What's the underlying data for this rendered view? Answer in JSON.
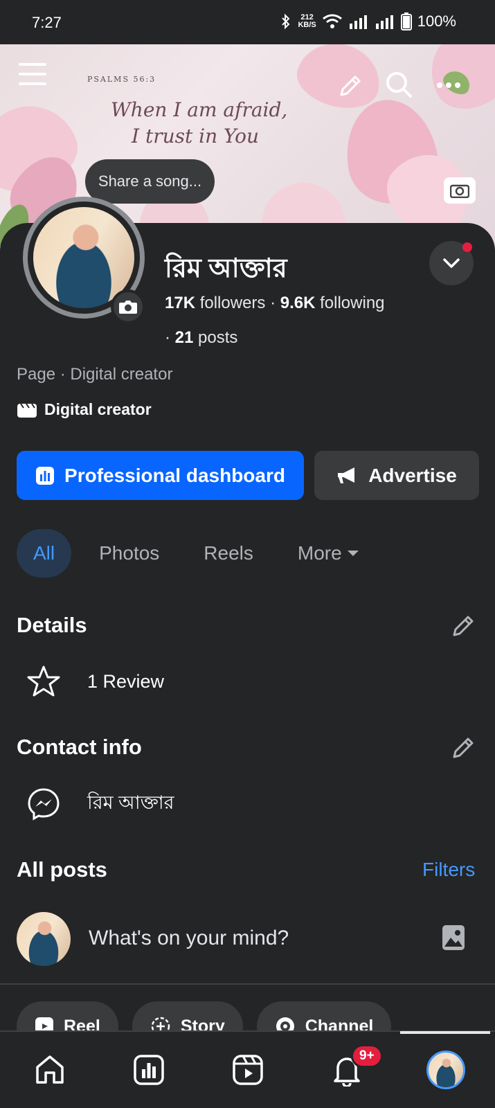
{
  "status_bar": {
    "time": "7:27",
    "network_speed_value": "212",
    "network_speed_unit": "KB/S",
    "battery": "100%"
  },
  "cover": {
    "verse_label": "PSALMS 56:3",
    "verse_line1": "When I am afraid,",
    "verse_line2": "I trust in You"
  },
  "song_tooltip": "Share a song...",
  "profile": {
    "name": "রিম আক্তার",
    "followers_count": "17K",
    "followers_label": "followers",
    "following_count": "9.6K",
    "following_label": "following",
    "posts_count": "21",
    "posts_label": "posts",
    "subtitle": "Page · Digital creator",
    "category": "Digital creator"
  },
  "actions": {
    "primary": "Professional dashboard",
    "secondary": "Advertise"
  },
  "tabs": [
    {
      "label": "All",
      "active": true
    },
    {
      "label": "Photos"
    },
    {
      "label": "Reels"
    },
    {
      "label": "More"
    }
  ],
  "details": {
    "title": "Details",
    "review": "1 Review"
  },
  "contact": {
    "title": "Contact info",
    "messenger": "রিম আক্তার"
  },
  "posts": {
    "title": "All posts",
    "filters": "Filters",
    "composer_placeholder": "What's on your mind?"
  },
  "chips": [
    {
      "label": "Reel"
    },
    {
      "label": "Story"
    },
    {
      "label": "Channel"
    }
  ],
  "bottom_nav": {
    "notifications_badge": "9+"
  },
  "colors": {
    "accent_blue": "#0866ff",
    "link_blue": "#4599ff",
    "badge_red": "#e41e3f",
    "background": "#242526"
  }
}
